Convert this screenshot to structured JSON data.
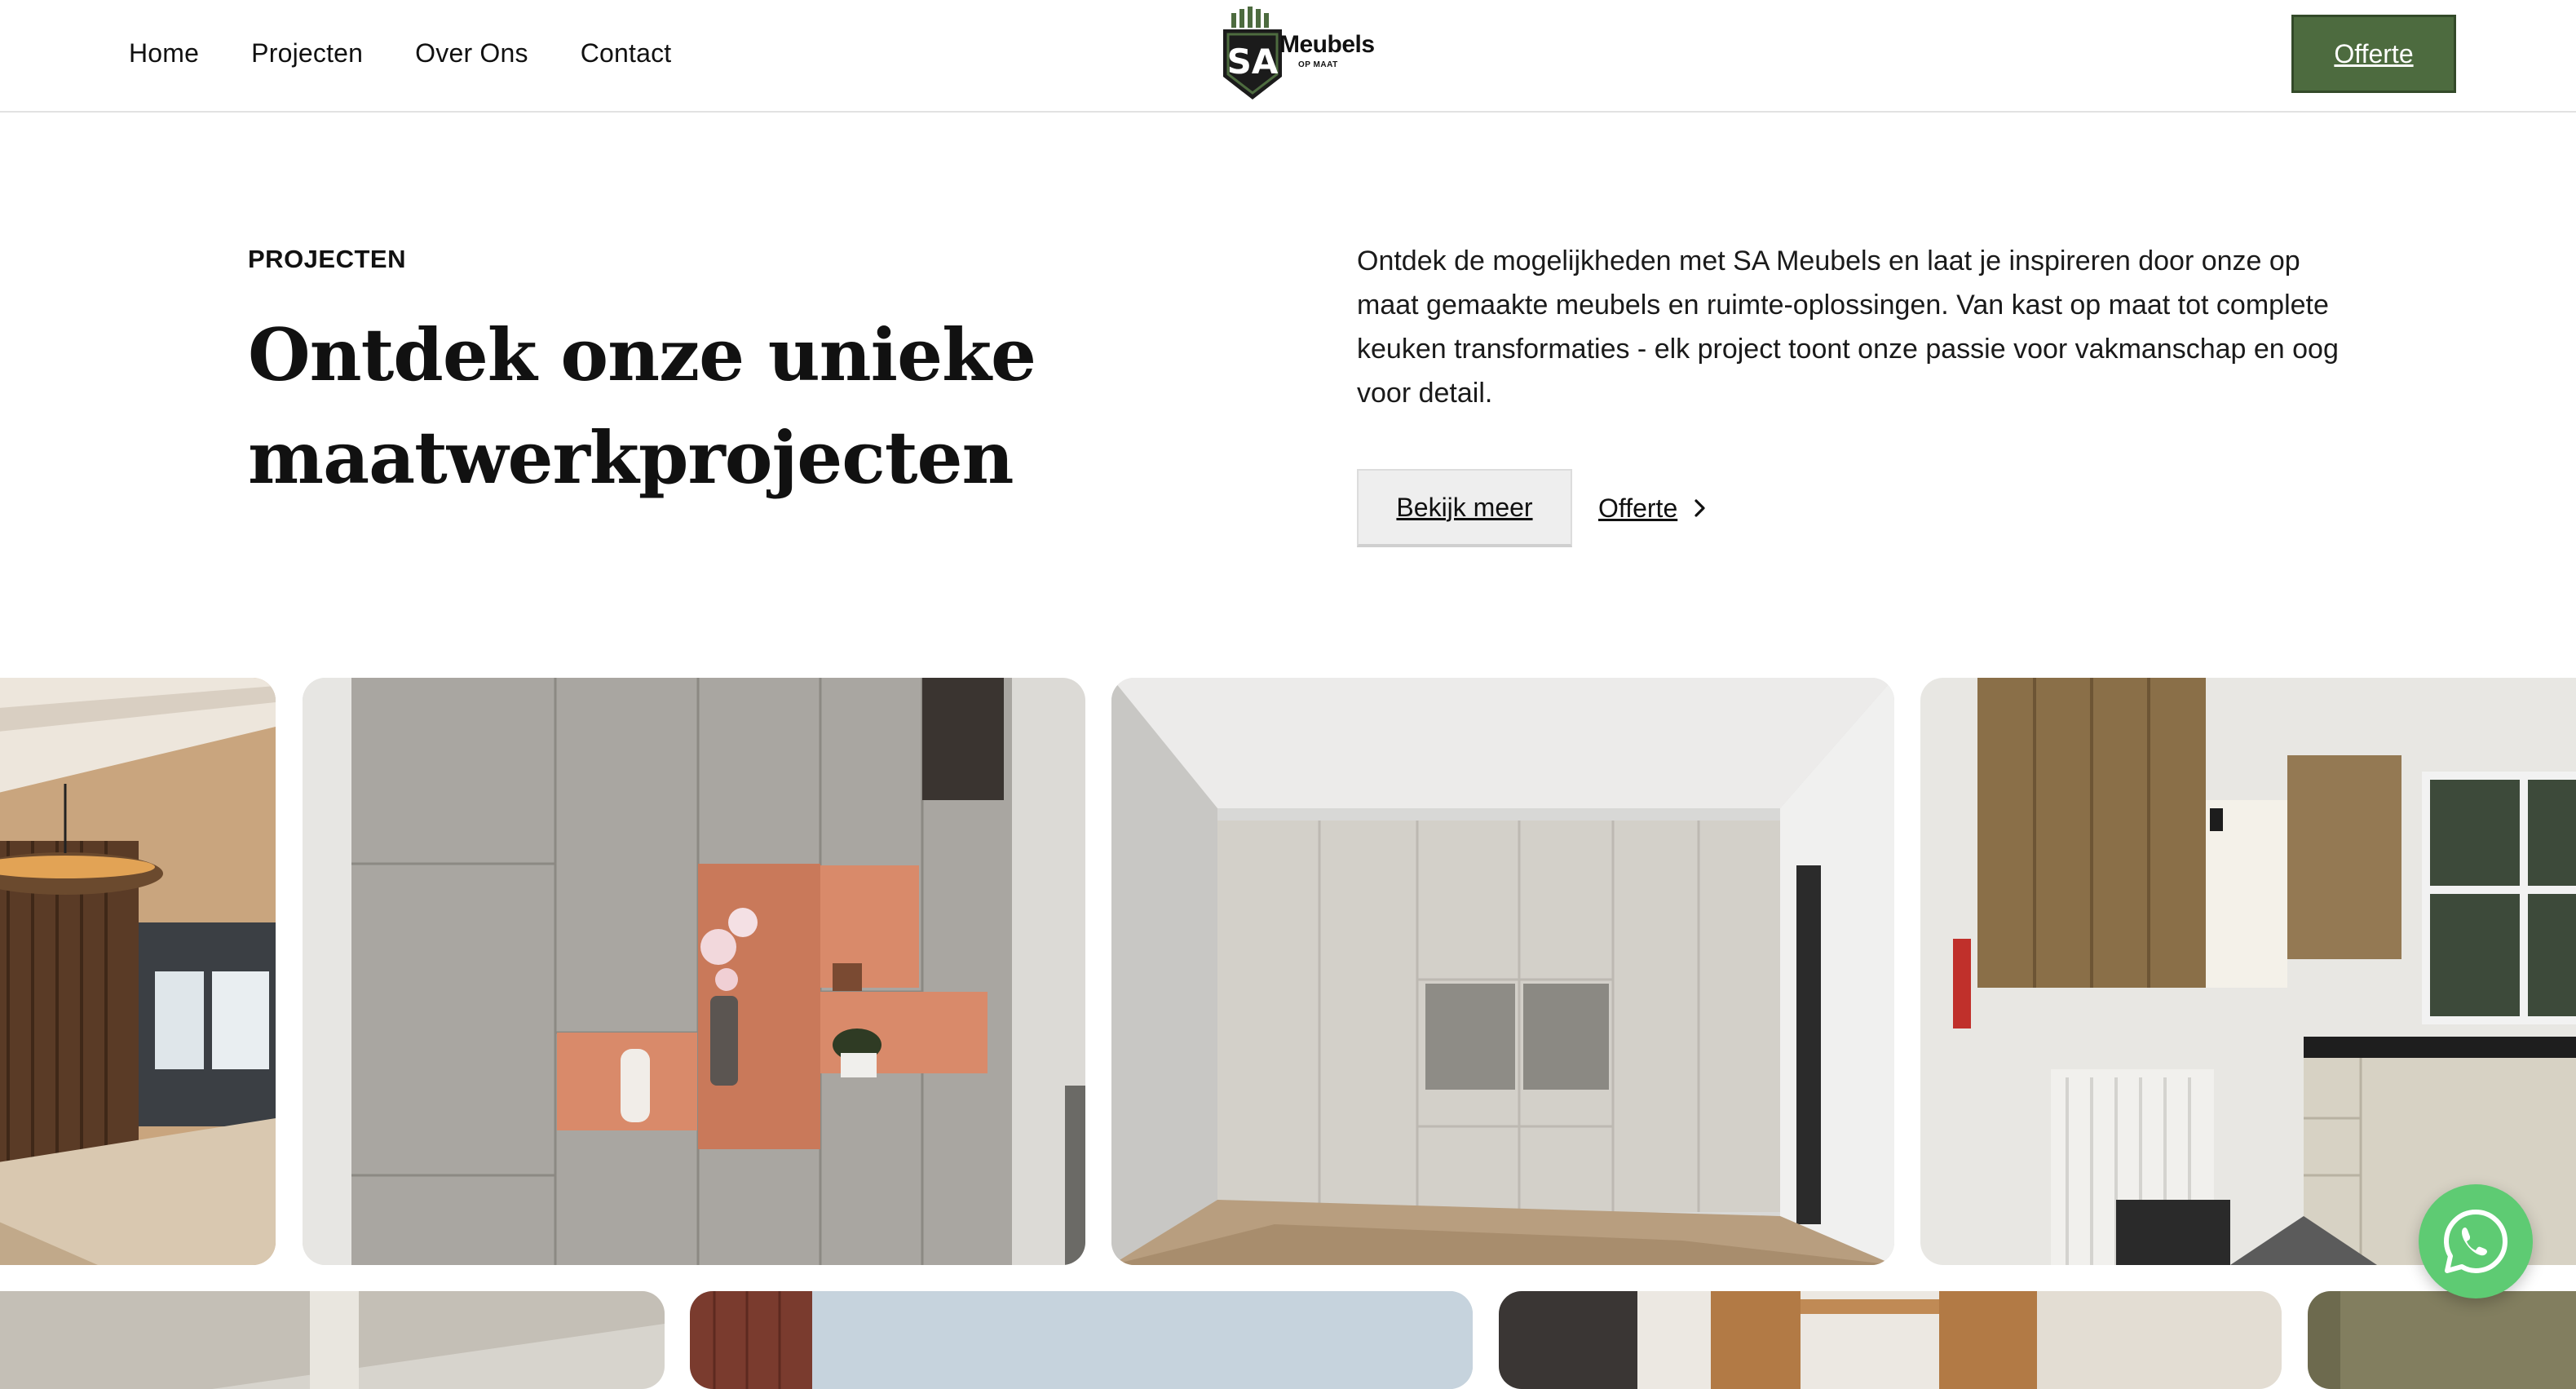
{
  "nav": {
    "links": [
      "Home",
      "Projecten",
      "Over Ons",
      "Contact"
    ],
    "cta_label": "Offerte"
  },
  "logo": {
    "initials": "SA",
    "word": "Meubels",
    "sub": "OP MAAT"
  },
  "intro": {
    "eyebrow": "PROJECTEN",
    "heading_line1": "Ontdek onze unieke",
    "heading_line2": "maatwerkprojecten",
    "lede": "Ontdek de mogelijkheden met SA Meubels en laat je inspireren door onze op maat gemaakte meubels en ruimte-oplossingen. Van kast op maat tot complete keuken transformaties - elk project toont onze passie voor vakmanschap en oog voor detail.",
    "btn_more": "Bekijk meer",
    "link_offer": "Offerte"
  },
  "colors": {
    "brand_green": "#4d6b3f",
    "whatsapp_green": "#5ecb73"
  },
  "icons": {
    "chevron": "chevron-right-icon",
    "chat": "whatsapp-icon"
  }
}
